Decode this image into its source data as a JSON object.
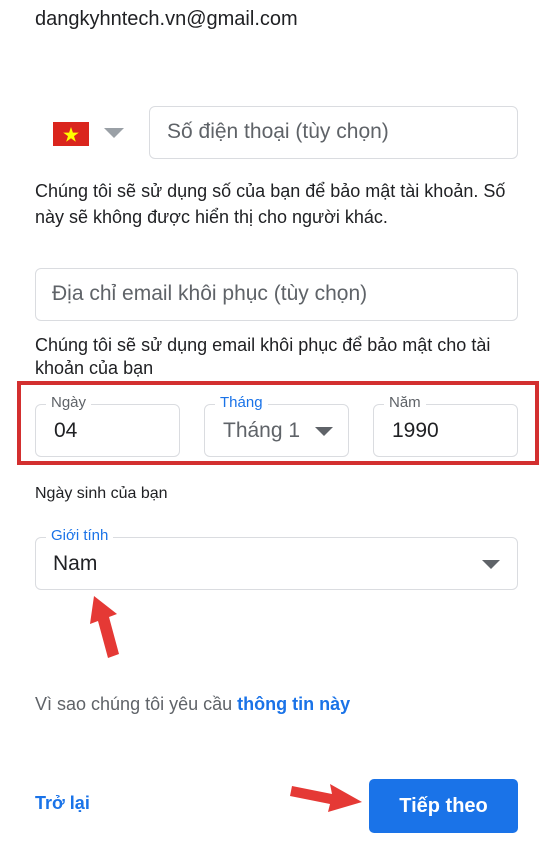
{
  "account": {
    "email": "dangkyhntech.vn@gmail.com"
  },
  "phone": {
    "country_flag": "vietnam-flag-icon",
    "placeholder": "Số điện thoại (tùy chọn)",
    "helper": "Chúng tôi sẽ sử dụng số của bạn để bảo mật tài khoản. Số này sẽ không được hiển thị cho người khác."
  },
  "recovery_email": {
    "placeholder": "Địa chỉ email khôi phục (tùy chọn)",
    "helper": "Chúng tôi sẽ sử dụng email khôi phục để bảo mật cho tài khoản của bạn"
  },
  "birthday": {
    "day": {
      "label": "Ngày",
      "value": "04"
    },
    "month": {
      "label": "Tháng",
      "value": "Tháng 1"
    },
    "year": {
      "label": "Năm",
      "value": "1990"
    },
    "helper": "Ngày sinh của bạn"
  },
  "gender": {
    "label": "Giới tính",
    "value": "Nam"
  },
  "why": {
    "text": "Vì sao chúng tôi yêu cầu ",
    "link": "thông tin này"
  },
  "nav": {
    "back": "Trở lại",
    "next": "Tiếp theo"
  },
  "colors": {
    "accent": "#1a73e8",
    "annotation": "#d32f2f",
    "flag_red": "#da251d",
    "flag_star": "#ffff00"
  }
}
